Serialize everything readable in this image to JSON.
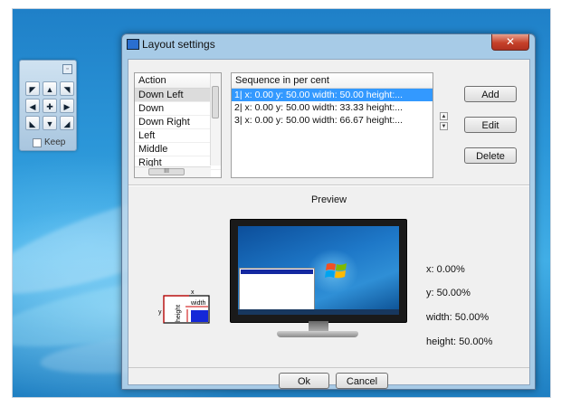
{
  "gadget": {
    "close_glyph": "▫",
    "buttons": [
      {
        "name": "up-left-arrow-icon",
        "glyph": "◤"
      },
      {
        "name": "up-arrow-icon",
        "glyph": "▲"
      },
      {
        "name": "up-right-arrow-icon",
        "glyph": "◥"
      },
      {
        "name": "left-arrow-icon",
        "glyph": "◀"
      },
      {
        "name": "center-move-icon",
        "glyph": "✚"
      },
      {
        "name": "right-arrow-icon",
        "glyph": "▶"
      },
      {
        "name": "down-left-arrow-icon",
        "glyph": "◣"
      },
      {
        "name": "down-arrow-icon",
        "glyph": "▼"
      },
      {
        "name": "down-right-arrow-icon",
        "glyph": "◢"
      }
    ],
    "keep_label": "Keep"
  },
  "window": {
    "title": "Layout settings",
    "close_glyph": "✕"
  },
  "action_list": {
    "header": "Action",
    "items": [
      "Down Left",
      "Down",
      "Down Right",
      "Left",
      "Middle",
      "Right"
    ],
    "hscroll_glyph": "III"
  },
  "sequence": {
    "header": "Sequence in per cent",
    "rows": [
      "1|  x:  0.00   y: 50.00   width:  50.00   height:...",
      "2|  x:  0.00   y: 50.00   width:  33.33   height:...",
      "3|  x:  0.00   y: 50.00   width:  66.67   height:..."
    ]
  },
  "spin": {
    "up_glyph": "▲",
    "down_glyph": "▼"
  },
  "buttons": {
    "add": "Add",
    "edit": "Edit",
    "delete": "Delete",
    "ok": "Ok",
    "cancel": "Cancel"
  },
  "preview": {
    "label": "Preview",
    "diagram_x": "x",
    "diagram_y": "y",
    "diagram_width": "width",
    "diagram_height": "height",
    "x_readout": "x: 0.00%",
    "y_readout": "y: 50.00%",
    "width_readout": "width: 50.00%",
    "height_readout": "height: 50.00%"
  }
}
